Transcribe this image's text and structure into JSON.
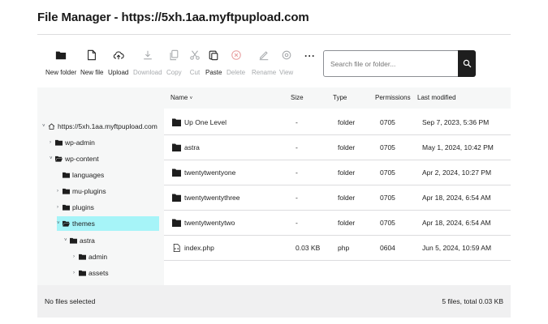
{
  "title": "File Manager - https://5xh.1aa.myftpupload.com",
  "toolbar": {
    "new_folder": "New folder",
    "new_file": "New file",
    "upload": "Upload",
    "download": "Download",
    "copy": "Copy",
    "cut": "Cut",
    "paste": "Paste",
    "delete": "Delete",
    "rename": "Rename",
    "view": "View",
    "more": "···"
  },
  "search": {
    "placeholder": "Search file or folder...",
    "value": ""
  },
  "tree": [
    {
      "label": "https://5xh.1aa.myftpupload.com",
      "toggle": "˅",
      "icon": "home-icon"
    },
    {
      "label": "wp-admin",
      "toggle": "›",
      "icon": "folder-icon"
    },
    {
      "label": "wp-content",
      "toggle": "˅",
      "icon": "folder-open-icon"
    },
    {
      "label": "languages",
      "toggle": "",
      "icon": "folder-icon"
    },
    {
      "label": "mu-plugins",
      "toggle": "›",
      "icon": "folder-icon"
    },
    {
      "label": "plugins",
      "toggle": "›",
      "icon": "folder-icon"
    },
    {
      "label": "themes",
      "toggle": "˅",
      "icon": "folder-open-icon",
      "selected": true
    },
    {
      "label": "astra",
      "toggle": "˅",
      "icon": "folder-icon"
    },
    {
      "label": "admin",
      "toggle": "›",
      "icon": "folder-icon"
    },
    {
      "label": "assets",
      "toggle": "›",
      "icon": "folder-icon"
    }
  ],
  "columns": {
    "name": "Name",
    "size": "Size",
    "type": "Type",
    "permissions": "Permissions",
    "modified": "Last modified"
  },
  "files": [
    {
      "name": "Up One Level",
      "size": "-",
      "type": "folder",
      "perm": "0705",
      "modified": "Sep 7, 2023, 5:36 PM",
      "icon": "folder-up-icon"
    },
    {
      "name": "astra",
      "size": "-",
      "type": "folder",
      "perm": "0705",
      "modified": "May 1, 2024, 10:42 PM",
      "icon": "folder-icon"
    },
    {
      "name": "twentytwentyone",
      "size": "-",
      "type": "folder",
      "perm": "0705",
      "modified": "Apr 2, 2024, 10:27 PM",
      "icon": "folder-icon"
    },
    {
      "name": "twentytwentythree",
      "size": "-",
      "type": "folder",
      "perm": "0705",
      "modified": "Apr 18, 2024, 6:54 AM",
      "icon": "folder-icon"
    },
    {
      "name": "twentytwentytwo",
      "size": "-",
      "type": "folder",
      "perm": "0705",
      "modified": "Apr 18, 2024, 6:54 AM",
      "icon": "folder-icon"
    },
    {
      "name": "index.php",
      "size": "0.03 KB",
      "type": "php",
      "perm": "0604",
      "modified": "Jun 5, 2024, 10:59 AM",
      "icon": "file-code-icon"
    }
  ],
  "footer": {
    "selection": "No files selected",
    "summary": "5 files, total 0.03 KB"
  },
  "colors": {
    "accent": "#1e1e1e",
    "selected": "#a6f4f8",
    "delete": "#d63638",
    "panel": "#f6f7f7",
    "footer": "#f0f0f1"
  }
}
